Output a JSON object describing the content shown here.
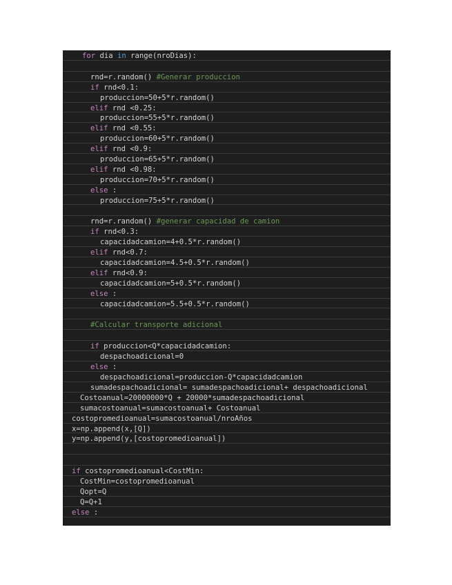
{
  "lines": [
    {
      "indent": 2,
      "parts": [
        [
          "kw",
          "for"
        ],
        [
          "",
          "dia "
        ],
        [
          "kw2",
          "in"
        ],
        [
          "",
          "range(nroDias):"
        ]
      ]
    },
    {
      "indent": 0,
      "parts": []
    },
    {
      "indent": 3,
      "parts": [
        [
          "",
          "rnd=r.random() "
        ],
        [
          "cm",
          "#Generar produccion"
        ]
      ]
    },
    {
      "indent": 3,
      "parts": [
        [
          "kw",
          "if"
        ],
        [
          "",
          "rnd<0.1:"
        ]
      ]
    },
    {
      "indent": 4,
      "parts": [
        [
          "",
          "produccion=50+5*r.random()"
        ]
      ]
    },
    {
      "indent": 3,
      "parts": [
        [
          "kw",
          "elif"
        ],
        [
          "",
          "rnd <0.25:"
        ]
      ]
    },
    {
      "indent": 4,
      "parts": [
        [
          "",
          "produccion=55+5*r.random()"
        ]
      ]
    },
    {
      "indent": 3,
      "parts": [
        [
          "kw",
          "elif"
        ],
        [
          "",
          "rnd <0.55:"
        ]
      ]
    },
    {
      "indent": 4,
      "parts": [
        [
          "",
          "produccion=60+5*r.random()"
        ]
      ]
    },
    {
      "indent": 3,
      "parts": [
        [
          "kw",
          "elif"
        ],
        [
          "",
          "rnd <0.9:"
        ]
      ]
    },
    {
      "indent": 4,
      "parts": [
        [
          "",
          "produccion=65+5*r.random()"
        ]
      ]
    },
    {
      "indent": 3,
      "parts": [
        [
          "kw",
          "elif"
        ],
        [
          "",
          "rnd <0.98:"
        ]
      ]
    },
    {
      "indent": 4,
      "parts": [
        [
          "",
          "produccion=70+5*r.random()"
        ]
      ]
    },
    {
      "indent": 3,
      "parts": [
        [
          "kw",
          "else"
        ],
        [
          "",
          ":"
        ]
      ]
    },
    {
      "indent": 4,
      "parts": [
        [
          "",
          "produccion=75+5*r.random()"
        ]
      ]
    },
    {
      "indent": 0,
      "parts": []
    },
    {
      "indent": 3,
      "parts": [
        [
          "",
          "rnd=r.random() "
        ],
        [
          "cm",
          "#generar capacidad de camion"
        ]
      ]
    },
    {
      "indent": 3,
      "parts": [
        [
          "kw",
          "if"
        ],
        [
          "",
          "rnd<0.3:"
        ]
      ]
    },
    {
      "indent": 4,
      "parts": [
        [
          "",
          "capacidadcamion=4+0.5*r.random()"
        ]
      ]
    },
    {
      "indent": 3,
      "parts": [
        [
          "kw",
          "elif"
        ],
        [
          "",
          "rnd<0.7:"
        ]
      ]
    },
    {
      "indent": 4,
      "parts": [
        [
          "",
          "capacidadcamion=4.5+0.5*r.random()"
        ]
      ]
    },
    {
      "indent": 3,
      "parts": [
        [
          "kw",
          "elif"
        ],
        [
          "",
          "rnd<0.9:"
        ]
      ]
    },
    {
      "indent": 4,
      "parts": [
        [
          "",
          "capacidadcamion=5+0.5*r.random()"
        ]
      ]
    },
    {
      "indent": 3,
      "parts": [
        [
          "kw",
          "else"
        ],
        [
          "",
          ":"
        ]
      ]
    },
    {
      "indent": 4,
      "parts": [
        [
          "",
          "capacidadcamion=5.5+0.5*r.random()"
        ]
      ]
    },
    {
      "indent": 0,
      "parts": []
    },
    {
      "indent": 3,
      "parts": [
        [
          "cm",
          "#Calcular transporte adicional"
        ]
      ]
    },
    {
      "indent": 0,
      "parts": []
    },
    {
      "indent": 3,
      "parts": [
        [
          "kw",
          "if"
        ],
        [
          "",
          "produccion<Q*capacidadcamion:"
        ]
      ]
    },
    {
      "indent": 4,
      "parts": [
        [
          "",
          "despachoadicional=0"
        ]
      ]
    },
    {
      "indent": 3,
      "parts": [
        [
          "kw",
          "else"
        ],
        [
          "",
          ":"
        ]
      ]
    },
    {
      "indent": 4,
      "parts": [
        [
          "",
          "despachoadicional=produccion-Q*capacidadcamion"
        ]
      ]
    },
    {
      "indent": 3,
      "parts": [
        [
          "",
          "sumadespachoadicional= sumadespachoadicional+ despachoadicional"
        ]
      ]
    },
    {
      "indent": 1,
      "parts": [
        [
          "",
          "Costoanual=20000000*Q + 20000*sumadespachoadicional"
        ]
      ]
    },
    {
      "indent": 1,
      "parts": [
        [
          "",
          "sumacostoanual=sumacostoanual+ Costoanual"
        ]
      ]
    },
    {
      "indent": 0,
      "parts": [
        [
          "",
          "costopromedioanual=sumacostoanual/nroAños"
        ]
      ]
    },
    {
      "indent": 0,
      "parts": [
        [
          "",
          "x=np.append(x,[Q])"
        ]
      ]
    },
    {
      "indent": 0,
      "parts": [
        [
          "",
          "y=np.append(y,[costopromedioanual])"
        ]
      ]
    },
    {
      "indent": 0,
      "parts": []
    },
    {
      "indent": 0,
      "parts": []
    },
    {
      "indent": 0,
      "parts": [
        [
          "kw",
          "if"
        ],
        [
          "",
          "costopromedioanual<CostMin:"
        ]
      ]
    },
    {
      "indent": 1,
      "parts": [
        [
          "",
          "CostMin=costopromedioanual"
        ]
      ]
    },
    {
      "indent": 1,
      "parts": [
        [
          "",
          "Qopt=Q"
        ]
      ]
    },
    {
      "indent": 1,
      "parts": [
        [
          "",
          "Q=Q+1"
        ]
      ]
    },
    {
      "indent": 0,
      "parts": [
        [
          "kw",
          "else"
        ],
        [
          "",
          ":"
        ]
      ]
    }
  ],
  "colors": {
    "background": "#1e1e1e",
    "text": "#d4d4d4",
    "keyword": "#c586c0",
    "keyword_alt": "#569cd6",
    "comment": "#6a9955"
  }
}
